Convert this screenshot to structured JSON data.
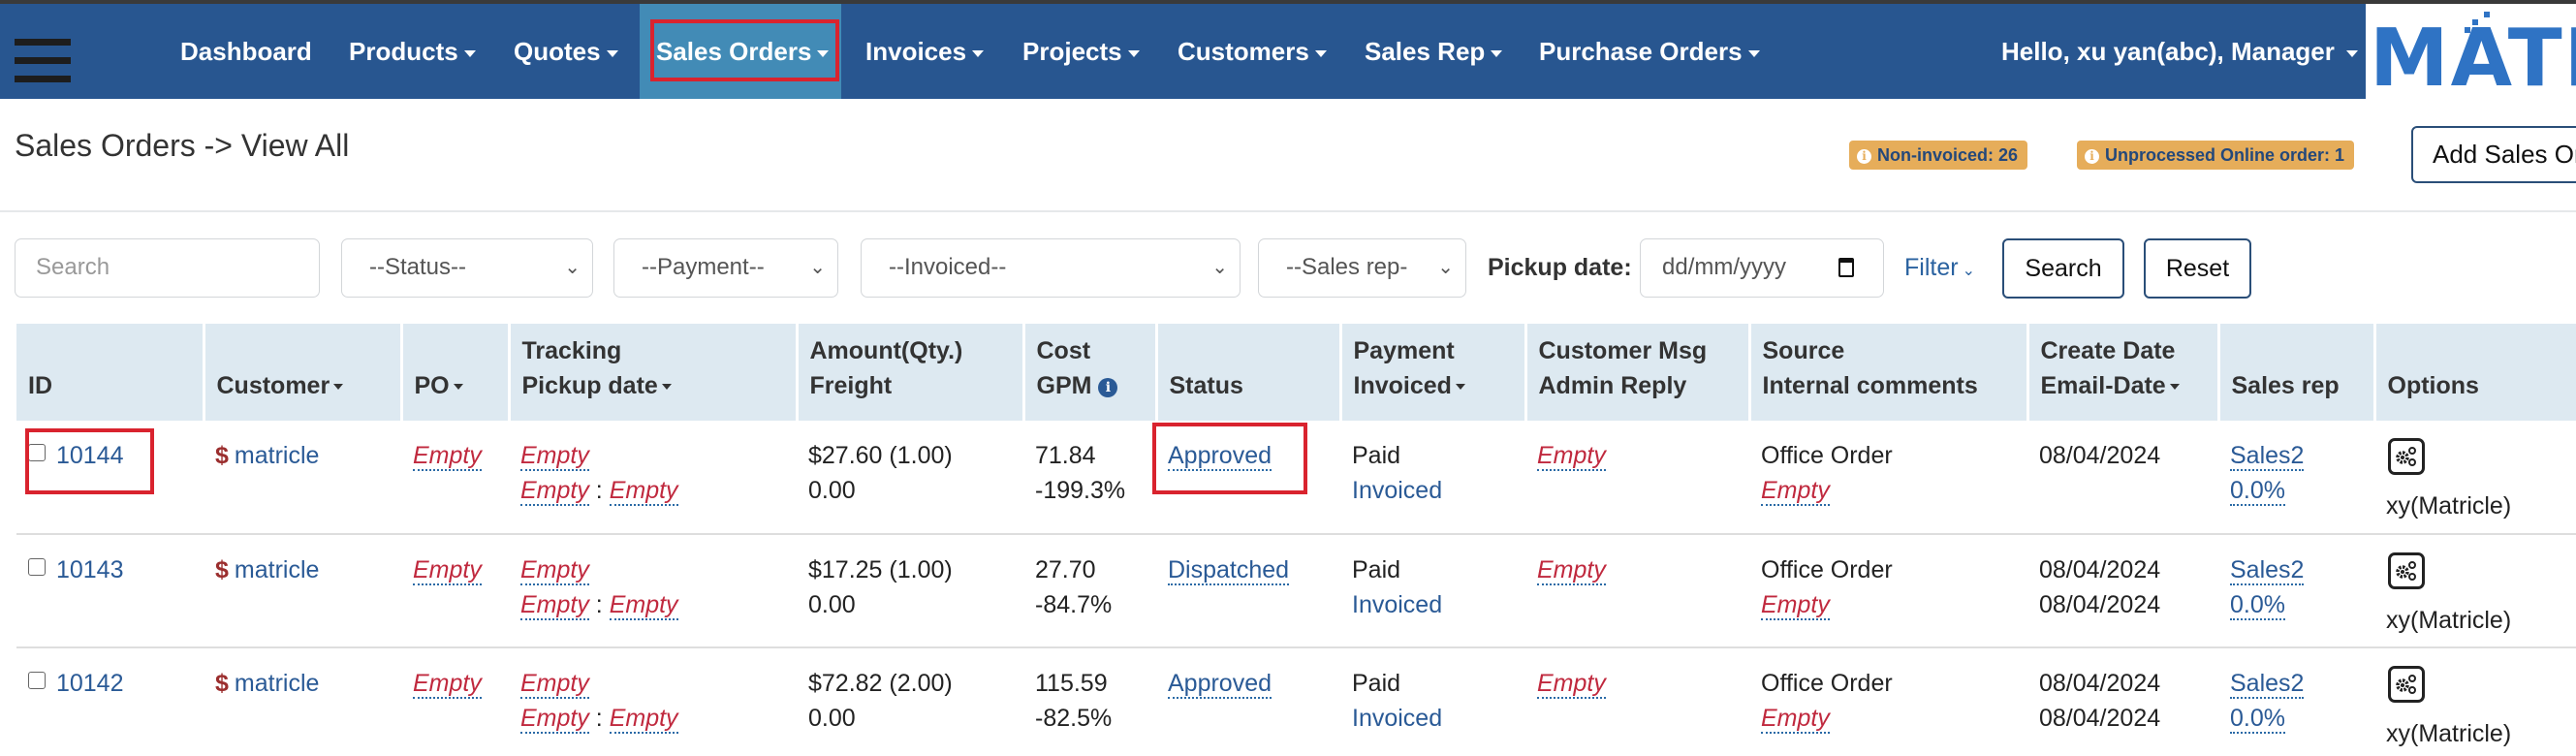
{
  "nav": {
    "items": [
      {
        "label": "Dashboard",
        "dropdown": false
      },
      {
        "label": "Products",
        "dropdown": true
      },
      {
        "label": "Quotes",
        "dropdown": true
      },
      {
        "label": "Sales Orders",
        "dropdown": true,
        "active": true
      },
      {
        "label": "Invoices",
        "dropdown": true
      },
      {
        "label": "Projects",
        "dropdown": true
      },
      {
        "label": "Customers",
        "dropdown": true
      },
      {
        "label": "Sales Rep",
        "dropdown": true
      },
      {
        "label": "Purchase Orders",
        "dropdown": true
      }
    ],
    "user_greeting": "Hello, xu yan(abc), Manager",
    "logo_text": "MATRIC"
  },
  "page": {
    "title": "Sales Orders -> View All",
    "badges": [
      {
        "label": "Non-invoiced: 26"
      },
      {
        "label": "Unprocessed Online order: 1"
      }
    ],
    "add_button": "Add Sales Order"
  },
  "filters": {
    "search_placeholder": "Search",
    "status": "--Status--",
    "payment": "--Payment--",
    "invoiced": "--Invoiced--",
    "sales_rep": "--Sales rep-",
    "pickup_label": "Pickup date:",
    "date_placeholder": "dd/mm/yyyy",
    "filter_link": "Filter",
    "search_button": "Search",
    "reset_button": "Reset"
  },
  "table": {
    "headers": {
      "id": "ID",
      "customer": "Customer",
      "po": "PO",
      "tracking": "Tracking",
      "pickup_date": "Pickup date",
      "amount": "Amount(Qty.)",
      "freight": "Freight",
      "cost": "Cost",
      "gpm": "GPM",
      "status": "Status",
      "payment": "Payment",
      "invoiced": "Invoiced",
      "customer_msg": "Customer Msg",
      "admin_reply": "Admin Reply",
      "source": "Source",
      "internal_comments": "Internal comments",
      "create_date": "Create Date",
      "email_date": "Email-Date",
      "sales_rep": "Sales rep",
      "options": "Options"
    },
    "rows": [
      {
        "id": "10144",
        "customer": "matricle",
        "po": "Empty",
        "tracking": "Empty",
        "pickup_a": "Empty",
        "pickup_b": "Empty",
        "amount": "$27.60 (1.00)",
        "freight": "0.00",
        "cost": "71.84",
        "gpm": "-199.3%",
        "status": "Approved",
        "payment": "Paid",
        "invoiced": "Invoiced",
        "customer_msg": "Empty",
        "source": "Office Order",
        "internal_comments": "Empty",
        "create_date": "08/04/2024",
        "email_date": "",
        "sales_rep": "Sales2",
        "commission": "0.0%",
        "owner": "xy(Matricle)"
      },
      {
        "id": "10143",
        "customer": "matricle",
        "po": "Empty",
        "tracking": "Empty",
        "pickup_a": "Empty",
        "pickup_b": "Empty",
        "amount": "$17.25 (1.00)",
        "freight": "0.00",
        "cost": "27.70",
        "gpm": "-84.7%",
        "status": "Dispatched",
        "payment": "Paid",
        "invoiced": "Invoiced",
        "customer_msg": "Empty",
        "source": "Office Order",
        "internal_comments": "Empty",
        "create_date": "08/04/2024",
        "email_date": "08/04/2024",
        "sales_rep": "Sales2",
        "commission": "0.0%",
        "owner": "xy(Matricle)"
      },
      {
        "id": "10142",
        "customer": "matricle",
        "po": "Empty",
        "tracking": "Empty",
        "pickup_a": "Empty",
        "pickup_b": "Empty",
        "amount": "$72.82 (2.00)",
        "freight": "0.00",
        "cost": "115.59",
        "gpm": "-82.5%",
        "status": "Approved",
        "payment": "Paid",
        "invoiced": "Invoiced",
        "customer_msg": "Empty",
        "source": "Office Order",
        "internal_comments": "Empty",
        "create_date": "08/04/2024",
        "email_date": "08/04/2024",
        "sales_rep": "Sales2",
        "commission": "0.0%",
        "owner": "xy(Matricle)"
      }
    ]
  },
  "colors": {
    "navbar": "#285690",
    "nav_active": "#428bb6",
    "highlight": "#d9232e",
    "badge": "#e6ad5a",
    "link": "#2a5a96",
    "empty": "#c0293e",
    "table_header": "#dde9f1"
  }
}
